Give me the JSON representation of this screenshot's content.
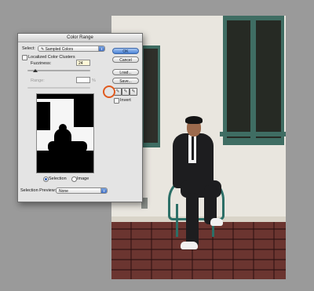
{
  "window": {
    "title": "Color Range"
  },
  "select": {
    "label": "Select:",
    "value": "Sampled Colors"
  },
  "localized": {
    "label": "Localized Color Clusters",
    "checked": false
  },
  "fuzziness": {
    "label": "Fuzziness:",
    "value": "24",
    "level": 0.12
  },
  "range": {
    "label": "Range:",
    "value": "",
    "unit": "%"
  },
  "buttons": {
    "ok": "OK",
    "cancel": "Cancel",
    "load": "Load...",
    "save": "Save..."
  },
  "eyedroppers": [
    "eyedropper-icon",
    "eyedropper-plus-icon",
    "eyedropper-minus-icon"
  ],
  "invert": {
    "label": "Invert",
    "checked": false
  },
  "view": {
    "selection_label": "Selection",
    "image_label": "Image",
    "selected": "selection"
  },
  "selection_preview": {
    "label": "Selection Preview:",
    "value": "None"
  },
  "colors": {
    "accent": "#4a82d6",
    "highlight_ring": "#e05a1e",
    "window_frame": "#3f6d63"
  }
}
